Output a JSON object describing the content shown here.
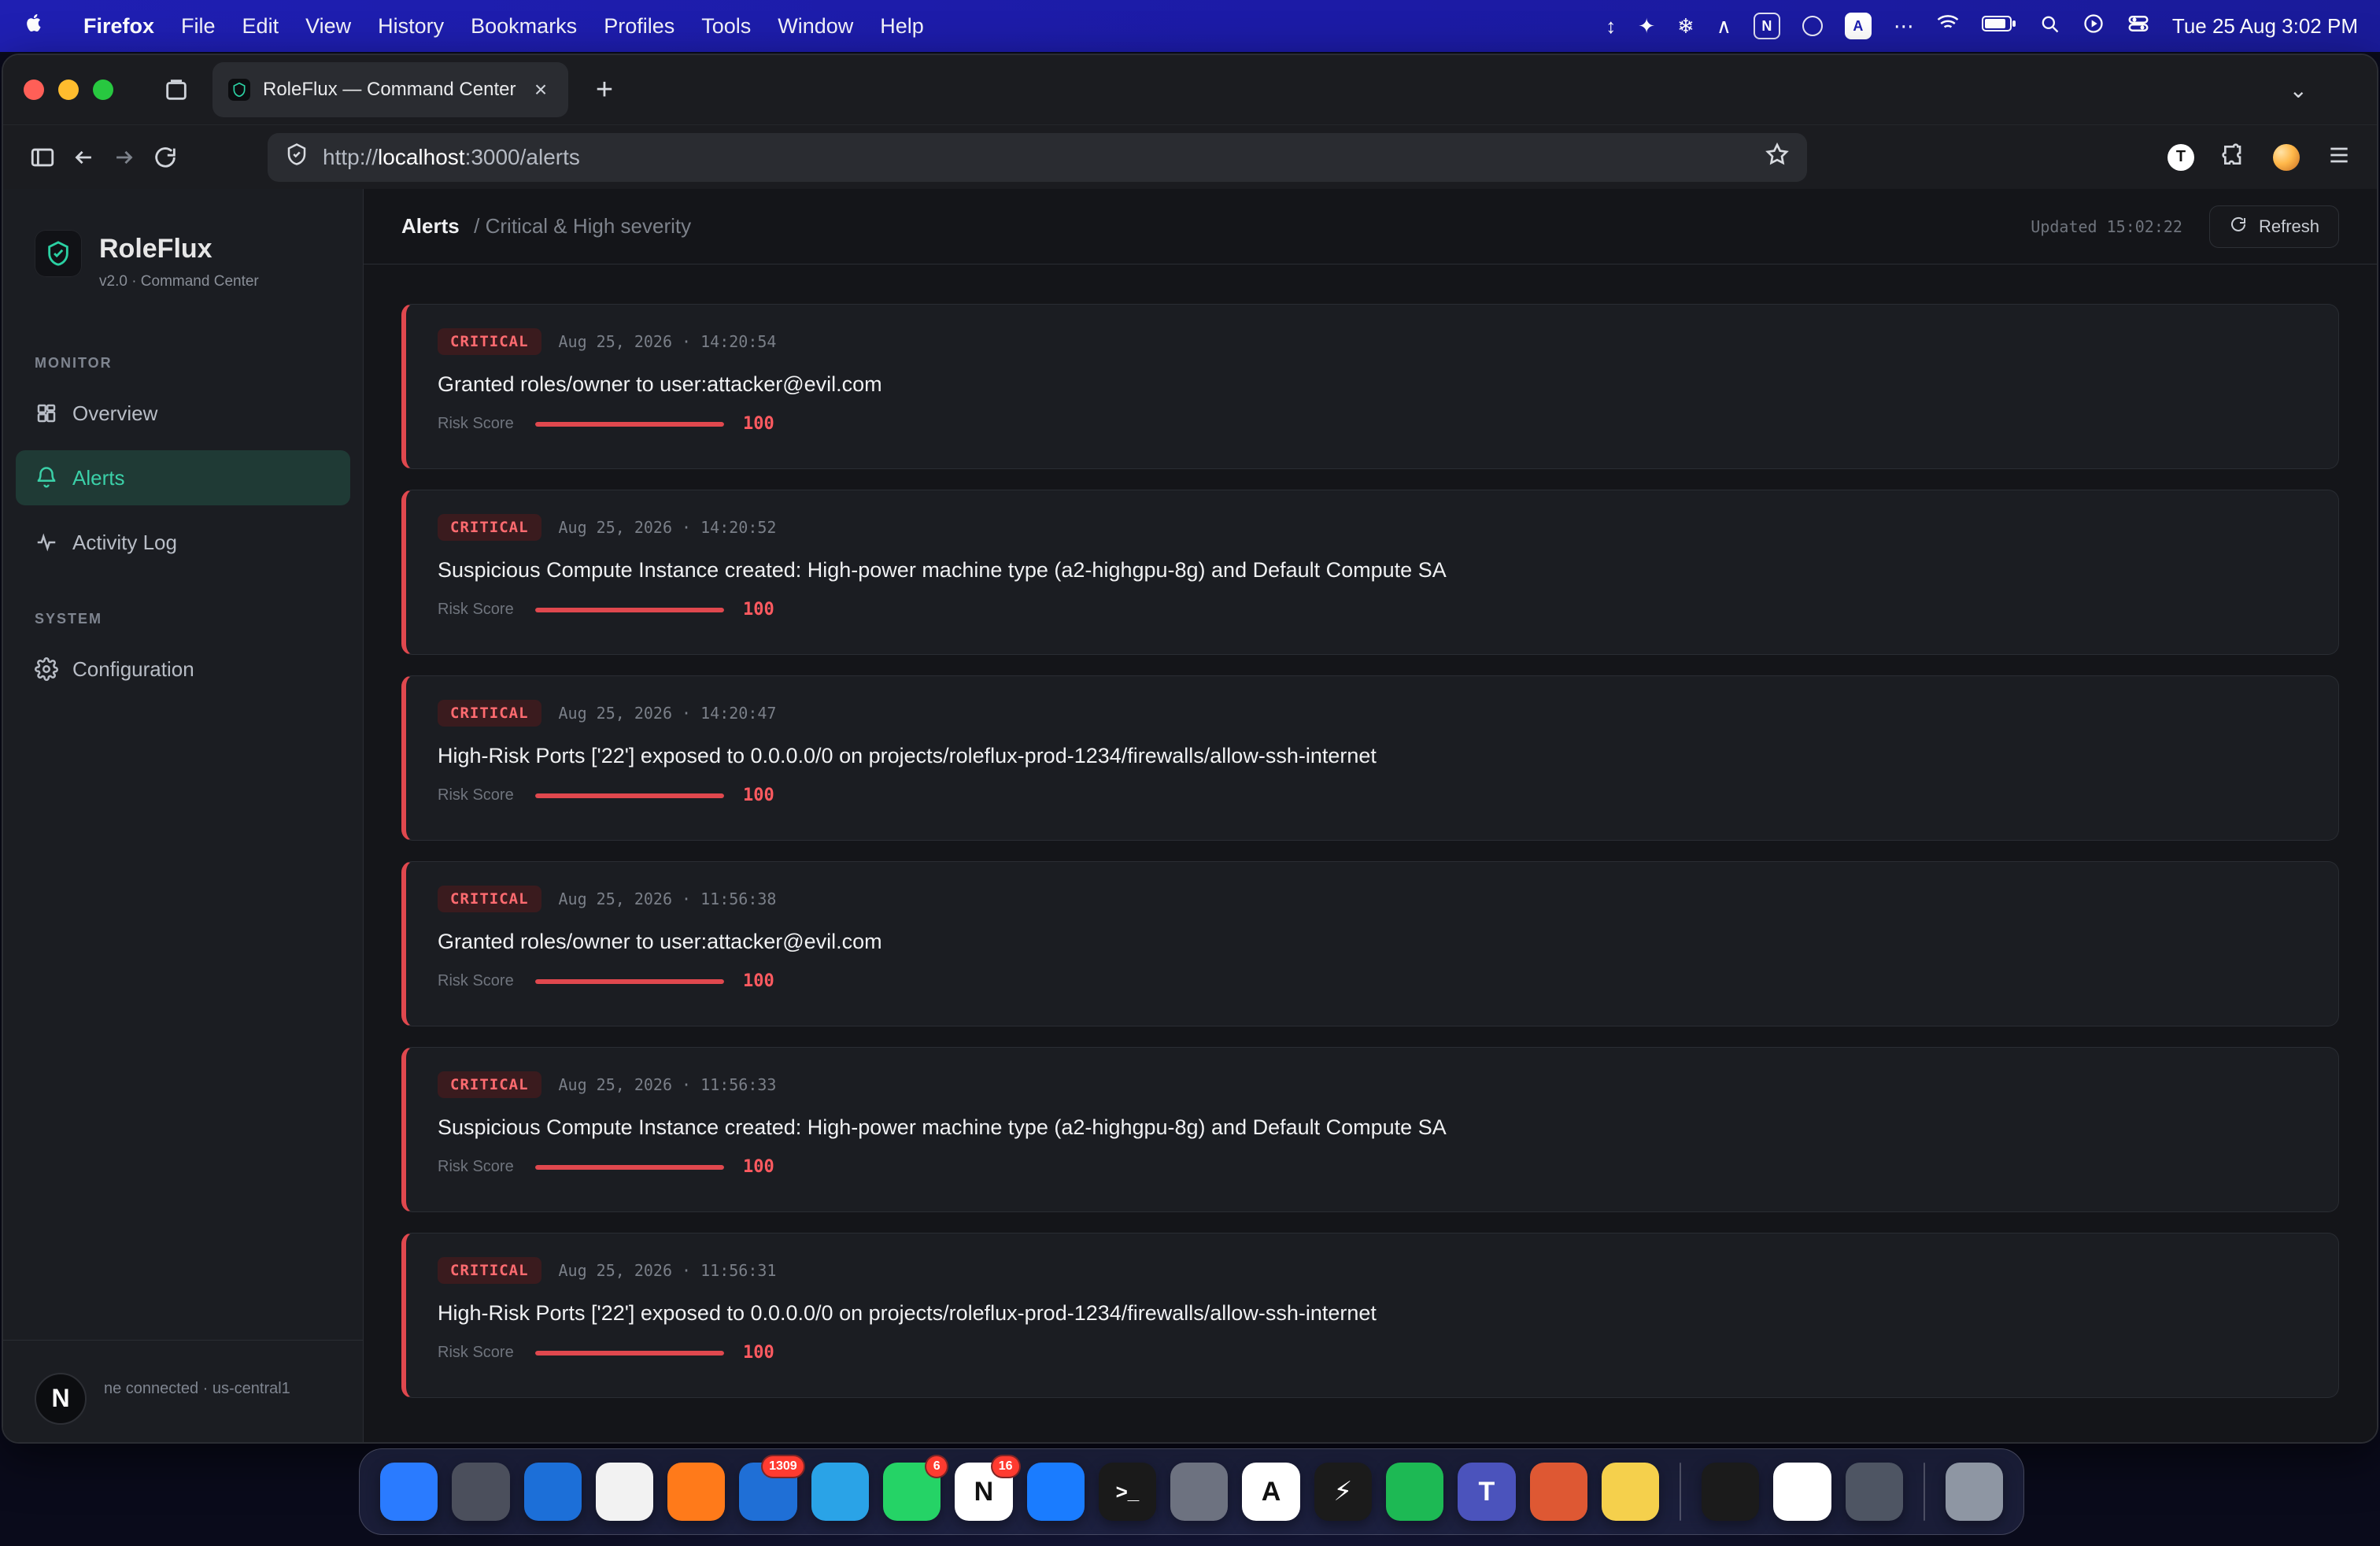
{
  "menubar": {
    "app": "Firefox",
    "items": [
      "File",
      "Edit",
      "View",
      "History",
      "Bookmarks",
      "Profiles",
      "Tools",
      "Window",
      "Help"
    ],
    "status_letters": [
      "N",
      "A"
    ],
    "datetime": "Tue 25 Aug  3:02 PM"
  },
  "browser": {
    "tab_title": "RoleFlux — Command Center",
    "url_scheme": "http://",
    "url_host": "localhost",
    "url_rest": ":3000/alerts",
    "avatar_letter": "T"
  },
  "sidebar": {
    "brand_name": "RoleFlux",
    "brand_sub": "v2.0 · Command Center",
    "sections": [
      {
        "label": "MONITOR",
        "items": [
          {
            "label": "Overview",
            "icon": "grid-icon",
            "active": false
          },
          {
            "label": "Alerts",
            "icon": "bell-icon",
            "active": true
          },
          {
            "label": "Activity Log",
            "icon": "activity-icon",
            "active": false
          }
        ]
      },
      {
        "label": "SYSTEM",
        "items": [
          {
            "label": "Configuration",
            "icon": "gear-icon",
            "active": false
          }
        ]
      }
    ],
    "footer_initial": "N",
    "footer_text": "ne connected · us-central1"
  },
  "main": {
    "breadcrumb_main": "Alerts",
    "breadcrumb_sub": "/ Critical & High severity",
    "updated": "Updated 15:02:22",
    "refresh_label": "Refresh",
    "alerts": [
      {
        "severity": "CRITICAL",
        "timestamp": "Aug 25, 2026 · 14:20:54",
        "title": "Granted roles/owner to user:attacker@evil.com",
        "risk_label": "Risk Score",
        "risk_score": 100
      },
      {
        "severity": "CRITICAL",
        "timestamp": "Aug 25, 2026 · 14:20:52",
        "title": "Suspicious Compute Instance created: High-power machine type (a2-highgpu-8g) and Default Compute SA",
        "risk_label": "Risk Score",
        "risk_score": 100
      },
      {
        "severity": "CRITICAL",
        "timestamp": "Aug 25, 2026 · 14:20:47",
        "title": "High-Risk Ports ['22'] exposed to 0.0.0.0/0 on projects/roleflux-prod-1234/firewalls/allow-ssh-internet",
        "risk_label": "Risk Score",
        "risk_score": 100
      },
      {
        "severity": "CRITICAL",
        "timestamp": "Aug 25, 2026 · 11:56:38",
        "title": "Granted roles/owner to user:attacker@evil.com",
        "risk_label": "Risk Score",
        "risk_score": 100
      },
      {
        "severity": "CRITICAL",
        "timestamp": "Aug 25, 2026 · 11:56:33",
        "title": "Suspicious Compute Instance created: High-power machine type (a2-highgpu-8g) and Default Compute SA",
        "risk_label": "Risk Score",
        "risk_score": 100
      },
      {
        "severity": "CRITICAL",
        "timestamp": "Aug 25, 2026 · 11:56:31",
        "title": "High-Risk Ports ['22'] exposed to 0.0.0.0/0 on projects/roleflux-prod-1234/firewalls/allow-ssh-internet",
        "risk_label": "Risk Score",
        "risk_score": 100
      }
    ]
  },
  "dock": {
    "items": [
      {
        "name": "finder-icon",
        "color": "#2a7bff",
        "glyph": ""
      },
      {
        "name": "launchpad-icon",
        "color": "#4b4f5c",
        "glyph": ""
      },
      {
        "name": "vscode-icon",
        "color": "#1c6fd8",
        "glyph": ""
      },
      {
        "name": "chrome-icon",
        "color": "#f2f2f2",
        "glyph": ""
      },
      {
        "name": "firefox-icon",
        "color": "#ff7a1a",
        "glyph": ""
      },
      {
        "name": "outlook-icon",
        "color": "#1f6fd6",
        "glyph": "",
        "badge": "1309"
      },
      {
        "name": "telegram-icon",
        "color": "#2aa3e7",
        "glyph": ""
      },
      {
        "name": "whatsapp-icon",
        "color": "#25d366",
        "glyph": "",
        "badge": "6"
      },
      {
        "name": "notion-icon",
        "color": "#ffffff",
        "glyph": "N",
        "badge": "16"
      },
      {
        "name": "xcode-icon",
        "color": "#1a7cff",
        "glyph": ""
      },
      {
        "name": "terminal-icon",
        "color": "#1a1a1a",
        "glyph": ">_"
      },
      {
        "name": "settings-icon",
        "color": "#6d7280",
        "glyph": ""
      },
      {
        "name": "app-store-icon",
        "color": "#ffffff",
        "glyph": "A"
      },
      {
        "name": "bolt-icon",
        "color": "#1b1b1b",
        "glyph": "⚡"
      },
      {
        "name": "spotify-icon",
        "color": "#1db954",
        "glyph": ""
      },
      {
        "name": "teams-icon",
        "color": "#4b53bc",
        "glyph": "T"
      },
      {
        "name": "duckduckgo-icon",
        "color": "#de5833",
        "glyph": ""
      },
      {
        "name": "notes-icon",
        "color": "#f5d04c",
        "glyph": ""
      },
      {
        "name": "sep-1",
        "sep": true
      },
      {
        "name": "activity-monitor-icon",
        "color": "#1b1b1b",
        "glyph": ""
      },
      {
        "name": "arc-icon",
        "color": "#ffffff",
        "glyph": ""
      },
      {
        "name": "disk-icon",
        "color": "#4e5563",
        "glyph": ""
      },
      {
        "name": "sep-2",
        "sep": true
      },
      {
        "name": "trash-icon",
        "color": "#8e96a3",
        "glyph": ""
      }
    ]
  }
}
